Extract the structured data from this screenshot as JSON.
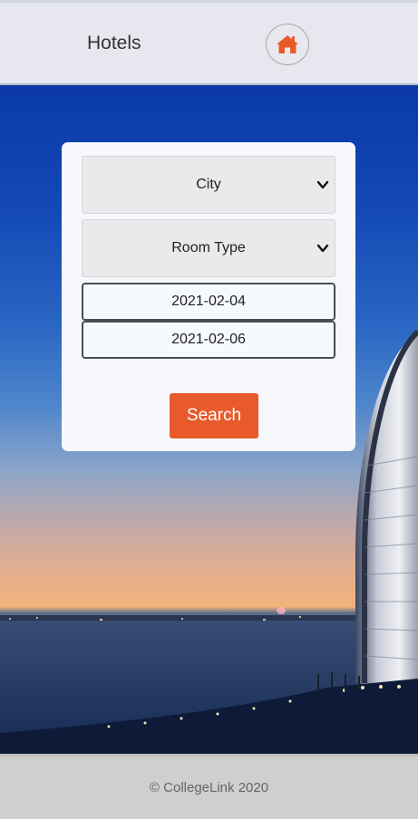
{
  "header": {
    "title": "Hotels",
    "home_icon": "home-icon"
  },
  "search_form": {
    "city_select": {
      "selected": "City"
    },
    "room_type_select": {
      "selected": "Room Type"
    },
    "check_in": "2021-02-04",
    "check_out": "2021-02-06",
    "search_label": "Search"
  },
  "footer": {
    "text": "© CollegeLink 2020"
  },
  "colors": {
    "accent": "#e85a2b",
    "header_bg": "#e6e7ef",
    "footer_bg": "#cfcfcf",
    "card_bg": "#f6f8fc"
  }
}
